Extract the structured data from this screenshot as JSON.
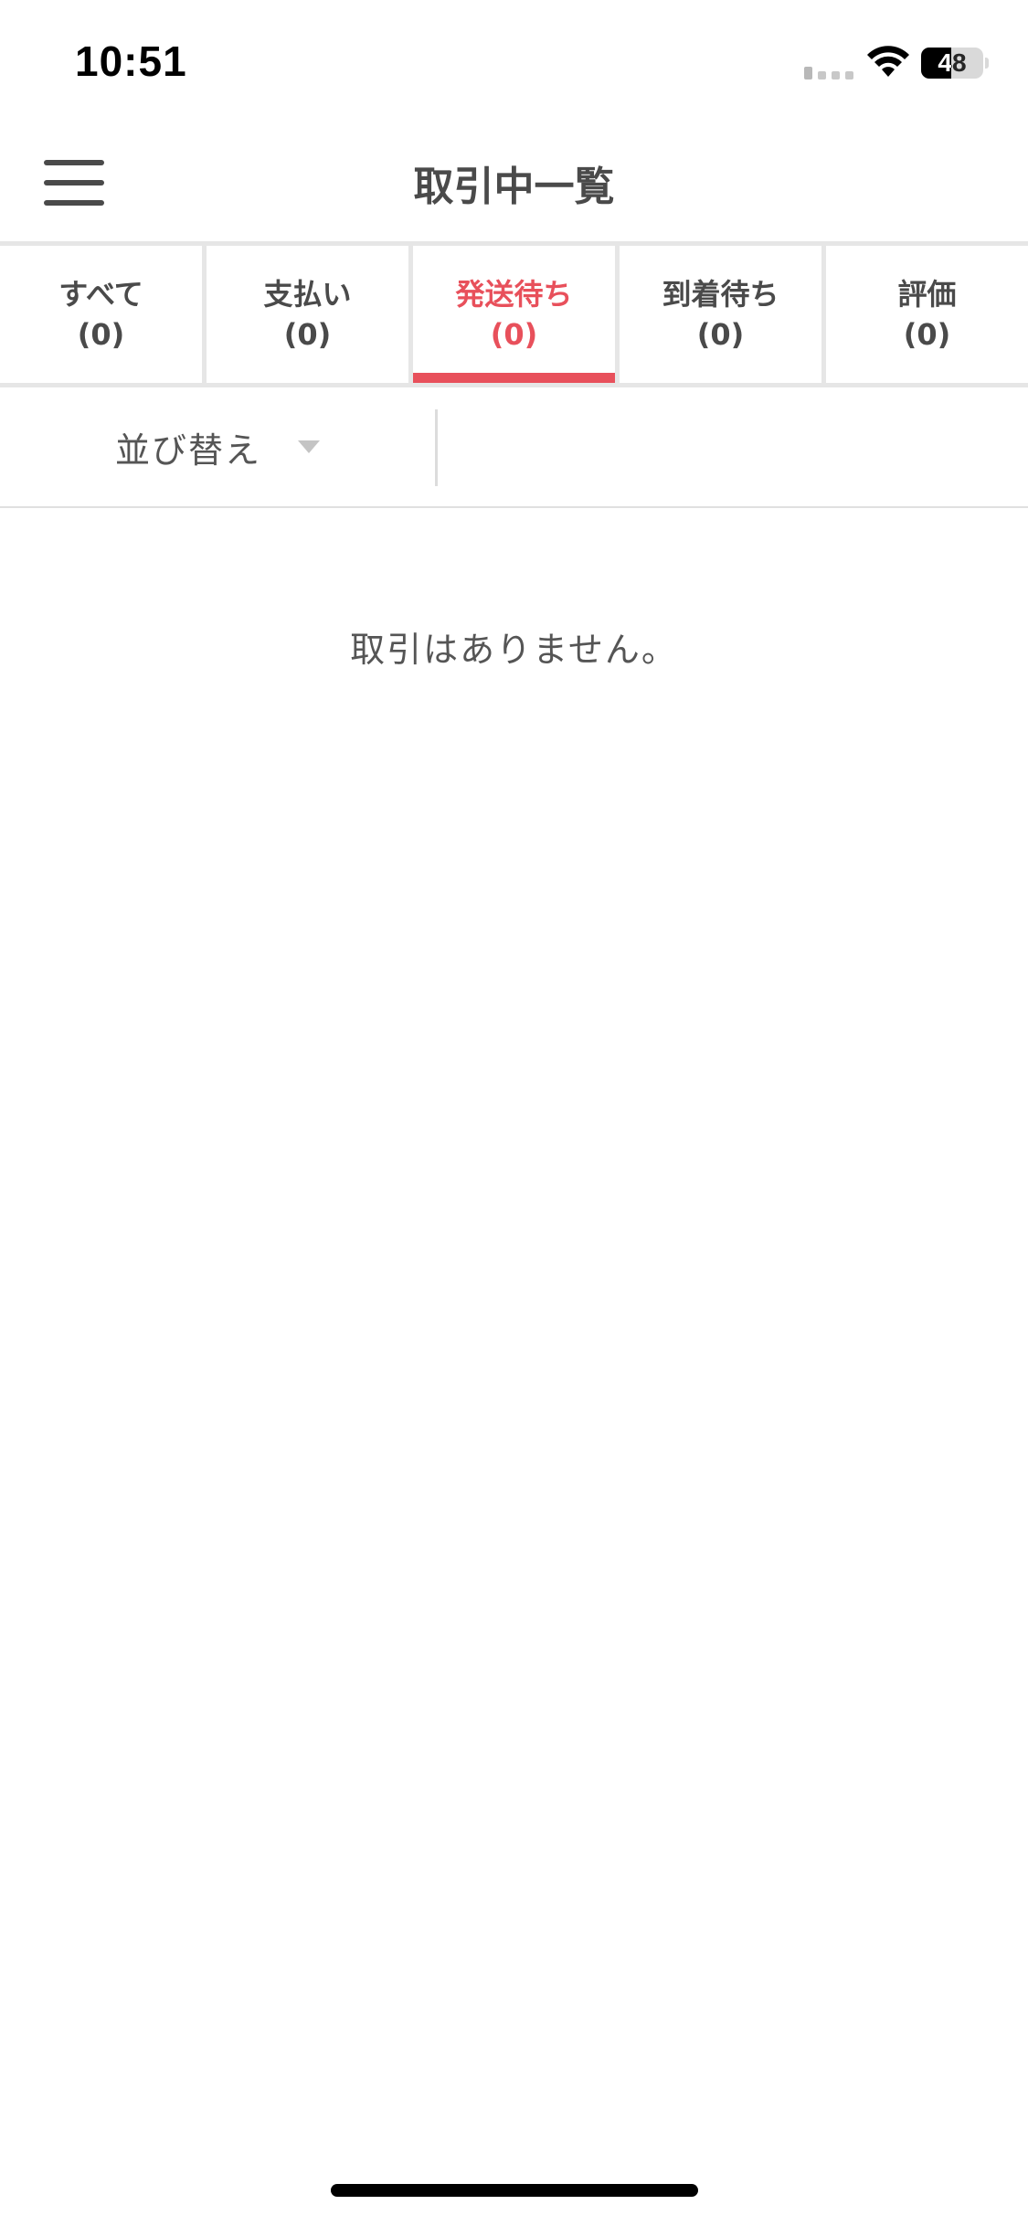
{
  "status_bar": {
    "time": "10:51",
    "battery_level": "48",
    "battery_fraction": 0.48
  },
  "header": {
    "title": "取引中一覧",
    "menu_icon": "hamburger-menu-icon"
  },
  "tabs": [
    {
      "label": "すべて",
      "count": "(0)",
      "active": false
    },
    {
      "label": "支払い",
      "count": "(0)",
      "active": false
    },
    {
      "label": "発送待ち",
      "count": "(0)",
      "active": true
    },
    {
      "label": "到着待ち",
      "count": "(0)",
      "active": false
    },
    {
      "label": "評価",
      "count": "(0)",
      "active": false
    }
  ],
  "sort": {
    "label": "並び替え",
    "icon": "caret-down-icon"
  },
  "empty_message": "取引はありません。",
  "colors": {
    "accent": "#e8505b",
    "text": "#4a4a4a",
    "tab_border": "#e6e6e6"
  }
}
